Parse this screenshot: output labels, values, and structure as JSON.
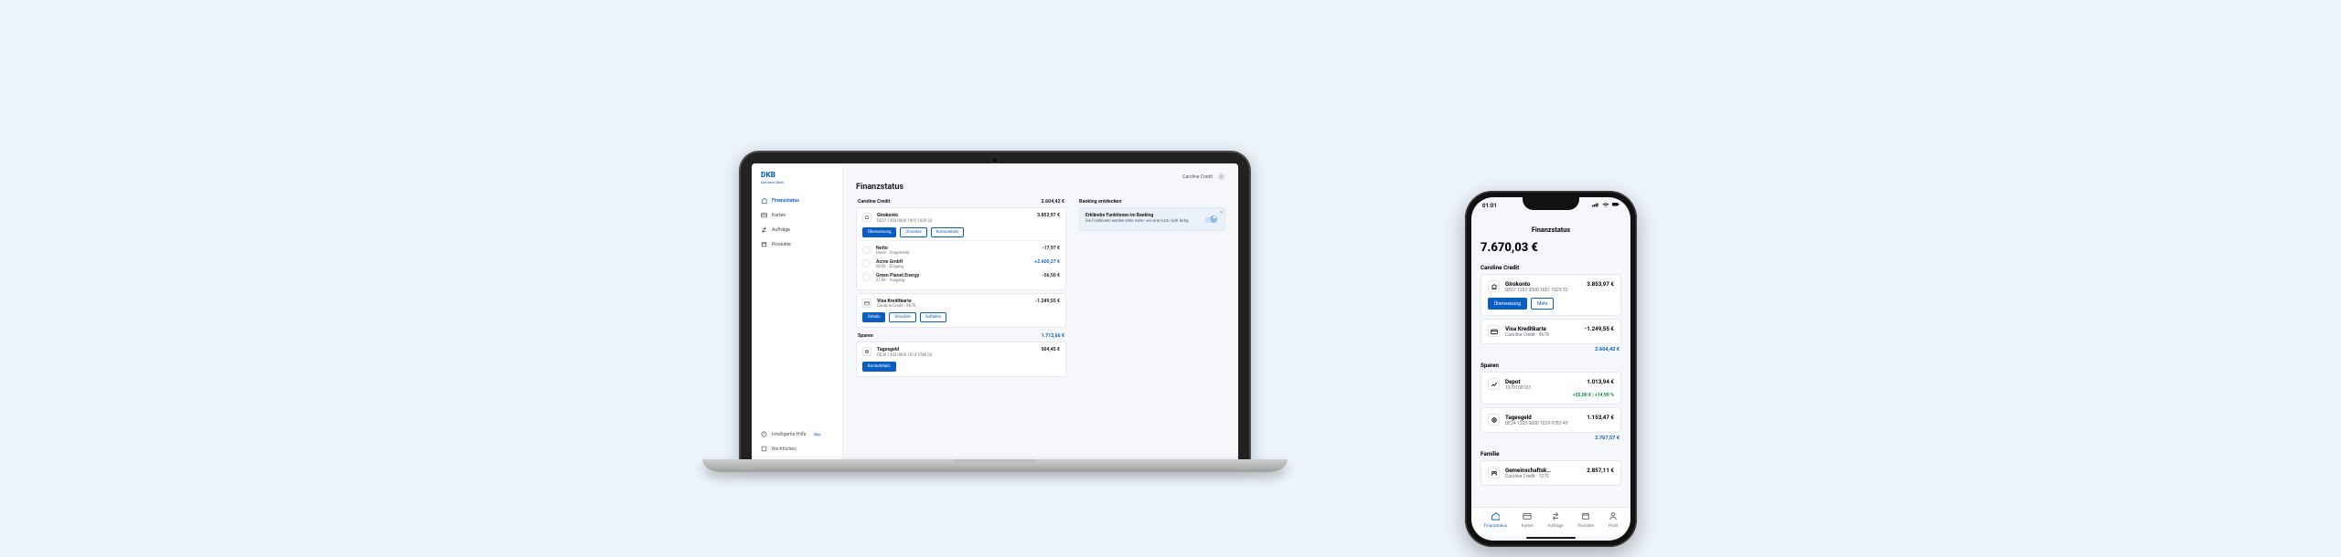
{
  "colors": {
    "brand": "#0a5ec2",
    "bg": "#eef4fc"
  },
  "laptop": {
    "logo": "DKB",
    "logo_tagline": "Das kann Bank",
    "nav": [
      {
        "label": "Finanzstatus",
        "icon": "home-icon",
        "active": true
      },
      {
        "label": "Karten",
        "icon": "card-icon"
      },
      {
        "label": "Aufträge",
        "icon": "transfer-icon"
      },
      {
        "label": "Produkte",
        "icon": "box-icon"
      }
    ],
    "nav_bottom": [
      {
        "label": "Intelligente Hilfe",
        "icon": "help-icon",
        "note": "Neu"
      },
      {
        "label": "Rechtliches",
        "icon": "legal-icon"
      }
    ],
    "user_name": "Caroline Credit",
    "title": "Finanzstatus",
    "sections": {
      "personal": {
        "header": "Caroline Credit",
        "total": "2.604,42 €",
        "accounts": [
          {
            "name": "Girokonto",
            "sub": "DE07 1203 0000 1001 1029 32",
            "balance": "3.853,97 €",
            "buttons": [
              "Überweisung",
              "Umsätze",
              "Kontodetails"
            ],
            "transactions": [
              {
                "name": "Netto",
                "sub": "Gleich · Vorgemerkt",
                "amount": "-17,97 €"
              },
              {
                "name": "Acme GmbH",
                "sub": "08.09. · Eingang",
                "amount": "+2.600,27 €",
                "positive": true
              },
              {
                "name": "Green Planet Energy",
                "sub": "07.09. · Ausgang",
                "amount": "-56,50 €"
              }
            ]
          },
          {
            "name": "Visa Kreditkarte",
            "sub": "Caroline Credit · 9678",
            "balance": "-1.249,55 €",
            "buttons": [
              "Details",
              "Umsätze",
              "Aufladen"
            ],
            "primary_idx": 0
          }
        ]
      },
      "sparen": {
        "header": "Sparen",
        "total": "1.712,66 €",
        "accounts": [
          {
            "name": "Tagesgeld",
            "sub": "DE30 1203 0000 1014 5786 03",
            "balance": "504,45 €",
            "buttons": [
              "Kontodetails"
            ]
          }
        ]
      }
    },
    "right": {
      "heading": "Banking entdecken",
      "promo_title": "Erkländre Funktionen im Banking",
      "promo_body": "Die Funktionen werden stets mehr—wir sind noch nicht fertig."
    }
  },
  "phone": {
    "status_time": "01:01",
    "title": "Finanzstatus",
    "big_balance": "7.670,03 €",
    "sections": [
      {
        "header": "Caroline Credit",
        "accounts": [
          {
            "icon": "bank-icon",
            "name": "Girokonto",
            "sub": "DE07 1203 0000 1001 1029 32",
            "amount": "3.853,97 €",
            "buttons": [
              "Überweisung",
              "Mehr"
            ]
          },
          {
            "icon": "card-icon",
            "name": "Visa Kreditkarte",
            "sub": "Caroline Credit · 9678",
            "amount": "-1.249,55 €"
          }
        ],
        "footer_total": "2.604,42 €"
      },
      {
        "header": "Sparen",
        "accounts": [
          {
            "icon": "depot-icon",
            "name": "Depot",
            "sub": "1670108163",
            "amount": "1.013,94 €",
            "perf": "+35,00 € | +14,90 %"
          },
          {
            "icon": "savings-icon",
            "name": "Tagesgeld",
            "sub": "DE24 1203 0000 1029 9783 49",
            "amount": "1.153,47 €"
          }
        ],
        "footer_total": "2.767,57 €"
      },
      {
        "header": "Familie",
        "accounts": [
          {
            "icon": "family-icon",
            "name": "Gemeinschaftsk…",
            "sub": "Caroline Credit · 1275",
            "amount": "2.857,11 €"
          }
        ]
      }
    ],
    "tabs": [
      {
        "label": "Finanzstatus",
        "icon": "home-icon",
        "active": true
      },
      {
        "label": "Karten",
        "icon": "card-icon"
      },
      {
        "label": "Aufträge",
        "icon": "transfer-icon"
      },
      {
        "label": "Produkte",
        "icon": "box-icon"
      },
      {
        "label": "Profil",
        "icon": "user-icon"
      }
    ]
  }
}
